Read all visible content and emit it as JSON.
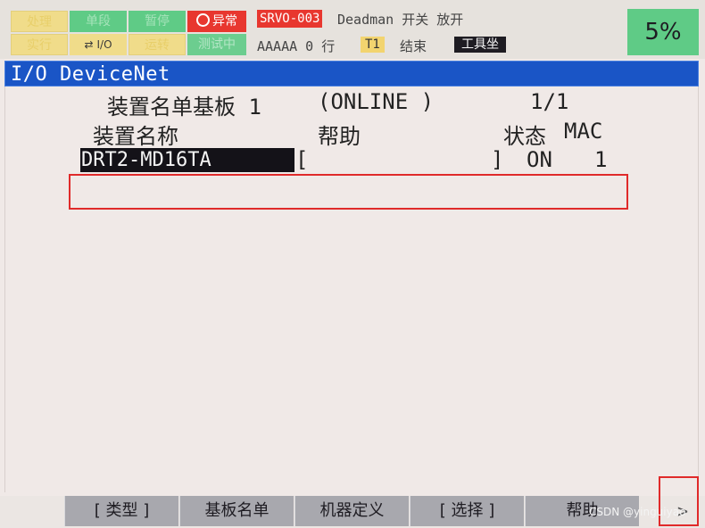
{
  "status": {
    "row1": [
      "处理",
      "单段",
      "暂停",
      "异常"
    ],
    "row2": [
      "实行",
      "I/O",
      "运转",
      "测试中"
    ],
    "alarm_code": "SRVO-003",
    "alarm_line": "Deadman   开关 放开",
    "program_line": "AAAAA 0 行",
    "mode": "T1",
    "run_state": "结束",
    "coord": "工具坐",
    "override": "5%"
  },
  "title": "I/O DeviceNet",
  "list": {
    "board_label": "装置名单基板 1",
    "board_state": "(ONLINE )",
    "page": "1/1",
    "col_name": "装置名称",
    "col_help": "帮助",
    "col_status": "状态",
    "col_mac": "MAC",
    "rows": [
      {
        "name": "DRT2-MD16TA",
        "help_open": "[",
        "help_close": "]",
        "status": "ON",
        "mac": "1"
      }
    ]
  },
  "fkeys": [
    "[ 类型 ]",
    "基板名单",
    "机器定义",
    "[ 选择 ]",
    "帮助"
  ],
  "next": ">",
  "watermark": "CSDN @yinguiyao",
  "colors": {
    "title_bar": "#1a55c6",
    "alarm_red": "#e8372f",
    "status_green": "#5fcb86",
    "status_yellow": "#f0dc8a",
    "highlight_red": "#e02a2a"
  }
}
